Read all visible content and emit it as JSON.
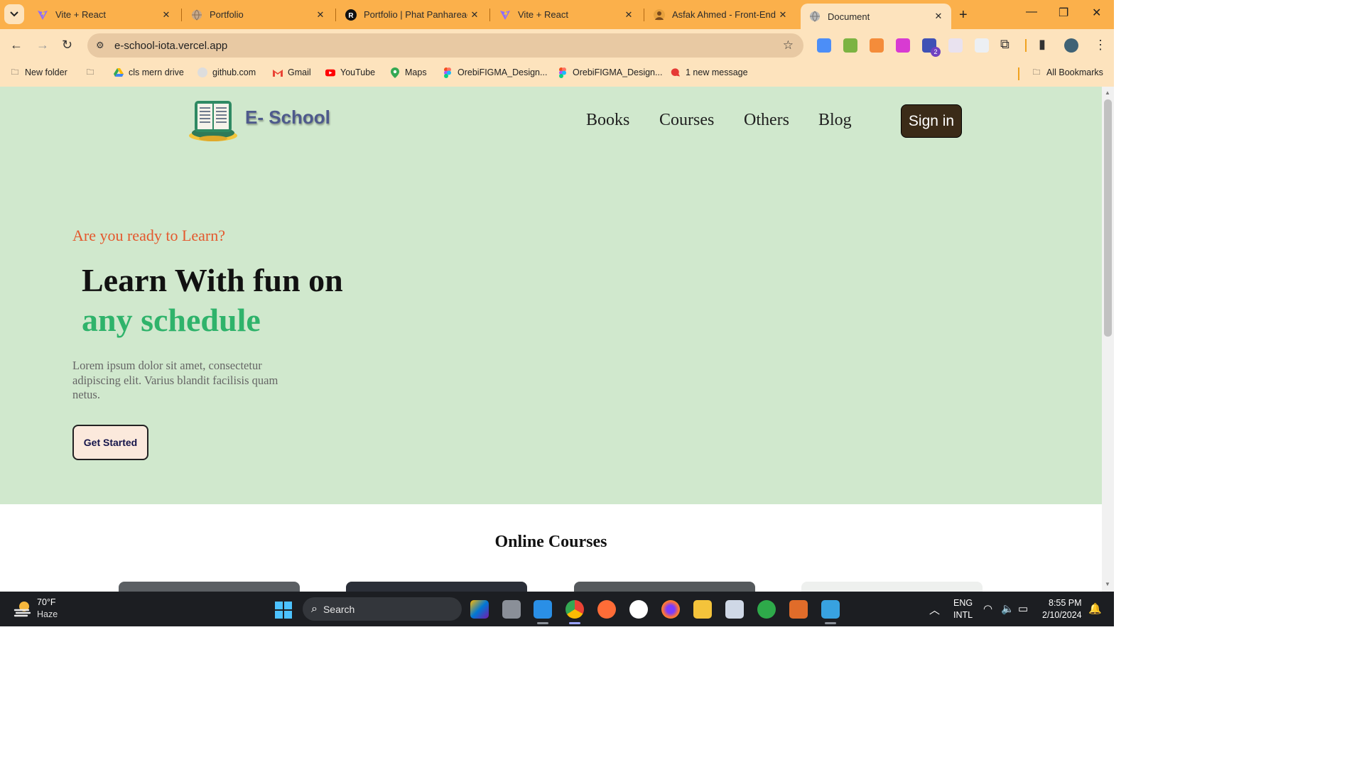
{
  "browser": {
    "tabs": [
      {
        "title": "Vite + React",
        "icon": "vite-icon"
      },
      {
        "title": "Portfolio",
        "icon": "globe-icon"
      },
      {
        "title": "Portfolio | Phat Panhareach",
        "icon": "r-logo-icon"
      },
      {
        "title": "Vite + React",
        "icon": "vite-icon"
      },
      {
        "title": "Asfak Ahmed - Front-End V",
        "icon": "avatar-icon"
      },
      {
        "title": "Document",
        "icon": "globe-icon",
        "active": true
      }
    ],
    "url": "e-school-iota.vercel.app",
    "bookmarks": [
      {
        "label": "New folder",
        "icon": "folder-icon"
      },
      {
        "label": "",
        "icon": "folder-icon"
      },
      {
        "label": "cls mern drive",
        "icon": "drive-icon"
      },
      {
        "label": "github.com",
        "icon": "github-icon"
      },
      {
        "label": "Gmail",
        "icon": "gmail-icon"
      },
      {
        "label": "YouTube",
        "icon": "youtube-icon"
      },
      {
        "label": "Maps",
        "icon": "maps-icon"
      },
      {
        "label": "OrebiFIGMA_Design...",
        "icon": "figma-icon"
      },
      {
        "label": "OrebiFIGMA_Design...",
        "icon": "figma-icon"
      },
      {
        "label": "1 new message",
        "icon": "message-icon"
      }
    ],
    "all_bookmarks": "All Bookmarks",
    "extension_badge": "2",
    "colors": {
      "tabbar": "#fbb04b",
      "toolbar": "#fde3bd"
    }
  },
  "site": {
    "brand": "E- School",
    "nav": [
      "Books",
      "Courses",
      "Others",
      "Blog"
    ],
    "signin": "Sign in",
    "hero": {
      "eyebrow": "Are you ready to Learn?",
      "headline_line1": "Learn With fun on",
      "headline_line2": "any schedule",
      "lead": "Lorem ipsum dolor sit amet, consectetur adipiscing elit. Varius blandit facilisis quam netus.",
      "cta": "Get Started"
    },
    "section_title": "Online Courses",
    "colors": {
      "hero_bg": "#d0e8cd",
      "accent_orange": "#e4582d",
      "accent_green": "#2fb36b",
      "signin_bg": "#3b2b18"
    }
  },
  "taskbar": {
    "weather_temp": "70°F",
    "weather_condition": "Haze",
    "search_label": "Search",
    "lang_line1": "ENG",
    "lang_line2": "INTL",
    "time": "8:55 PM",
    "date": "2/10/2024"
  }
}
